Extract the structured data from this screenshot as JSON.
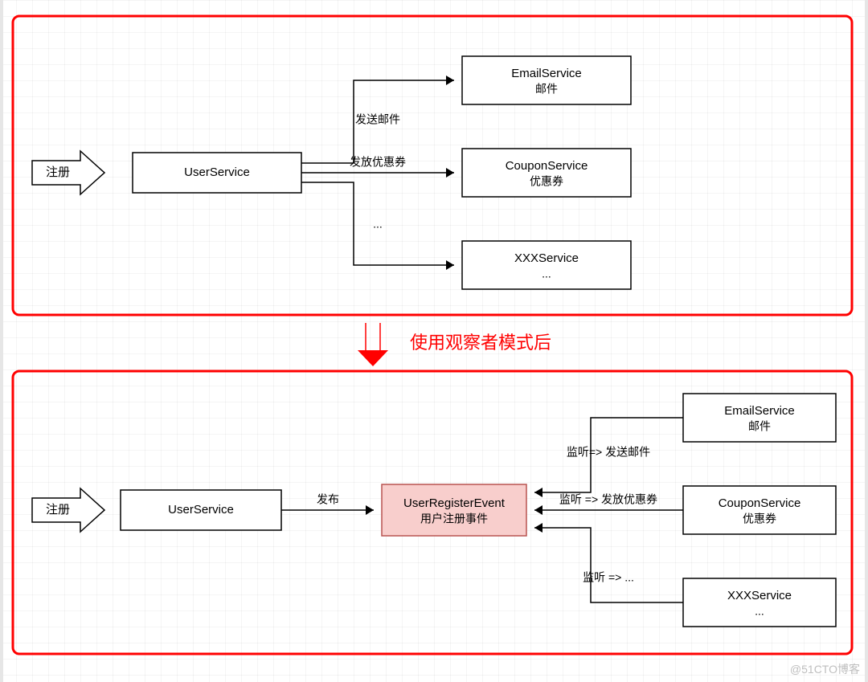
{
  "top": {
    "register_label": "注册",
    "user_service": "UserService",
    "edges": {
      "send_email": "发送邮件",
      "give_coupon": "发放优惠券",
      "etc": "..."
    },
    "services": {
      "email": {
        "name": "EmailService",
        "sub": "邮件"
      },
      "coupon": {
        "name": "CouponService",
        "sub": "优惠券"
      },
      "xxx": {
        "name": "XXXService",
        "sub": "..."
      }
    }
  },
  "middle": {
    "caption": "使用观察者模式后"
  },
  "bottom": {
    "register_label": "注册",
    "user_service": "UserService",
    "publish_label": "发布",
    "event": {
      "name": "UserRegisterEvent",
      "sub": "用户注册事件"
    },
    "edges": {
      "listen_email": "监听=> 发送邮件",
      "listen_coupon": "监听 => 发放优惠券",
      "listen_etc": "监听 => ..."
    },
    "services": {
      "email": {
        "name": "EmailService",
        "sub": "邮件"
      },
      "coupon": {
        "name": "CouponService",
        "sub": "优惠券"
      },
      "xxx": {
        "name": "XXXService",
        "sub": "..."
      }
    }
  },
  "watermark": "@51CTO博客"
}
